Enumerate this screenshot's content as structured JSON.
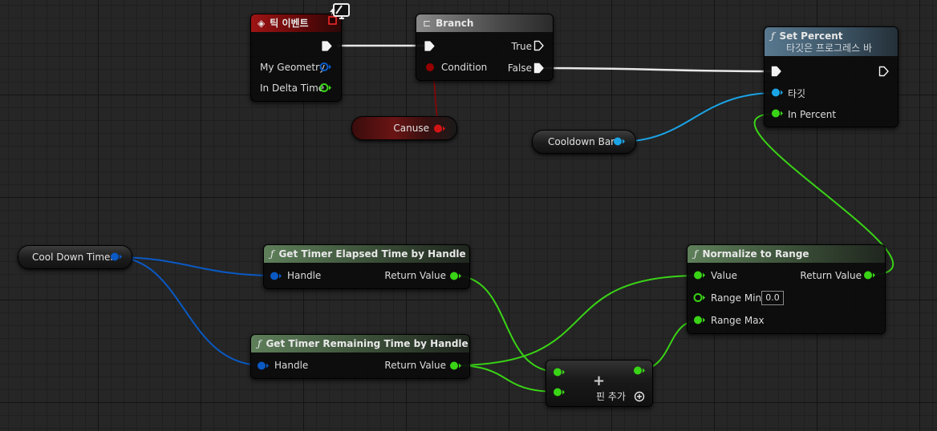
{
  "nodes": {
    "tick_event": {
      "title": "틱 이벤트",
      "pins": {
        "my_geometry": "My Geometry",
        "in_delta_time": "In Delta Time"
      }
    },
    "branch": {
      "title": "Branch",
      "pins": {
        "condition": "Condition",
        "true": "True",
        "false": "False"
      }
    },
    "set_percent": {
      "title": "Set Percent",
      "subtitle": "타깃은 프로그레스 바",
      "pins": {
        "target": "타깃",
        "in_percent": "In Percent"
      }
    },
    "get_elapsed": {
      "title": "Get Timer Elapsed Time by Handle",
      "pins": {
        "handle": "Handle",
        "return_value": "Return Value"
      }
    },
    "get_remaining": {
      "title": "Get Timer Remaining Time by Handle",
      "pins": {
        "handle": "Handle",
        "return_value": "Return Value"
      }
    },
    "normalize": {
      "title": "Normalize to Range",
      "pins": {
        "value": "Value",
        "range_min": "Range Min",
        "range_min_default": "0.0",
        "range_max": "Range Max",
        "return_value": "Return Value"
      }
    },
    "add": {
      "symbol": "+",
      "add_pin": "핀 추가"
    }
  },
  "variables": {
    "canuse": "Canuse",
    "cooldown_bar": "Cooldown Bar",
    "cool_down_timer": "Cool Down Timer"
  },
  "icons": {
    "function": "ƒ",
    "event": "event-diamond-icon",
    "branch": "branch-icon"
  },
  "colors": {
    "exec": "#ffffff",
    "bool": "#950000",
    "object": "#00a8f4",
    "struct_handle": "#0a59c4",
    "float": "#39d416",
    "struct_geometry": "#0a59c4"
  }
}
